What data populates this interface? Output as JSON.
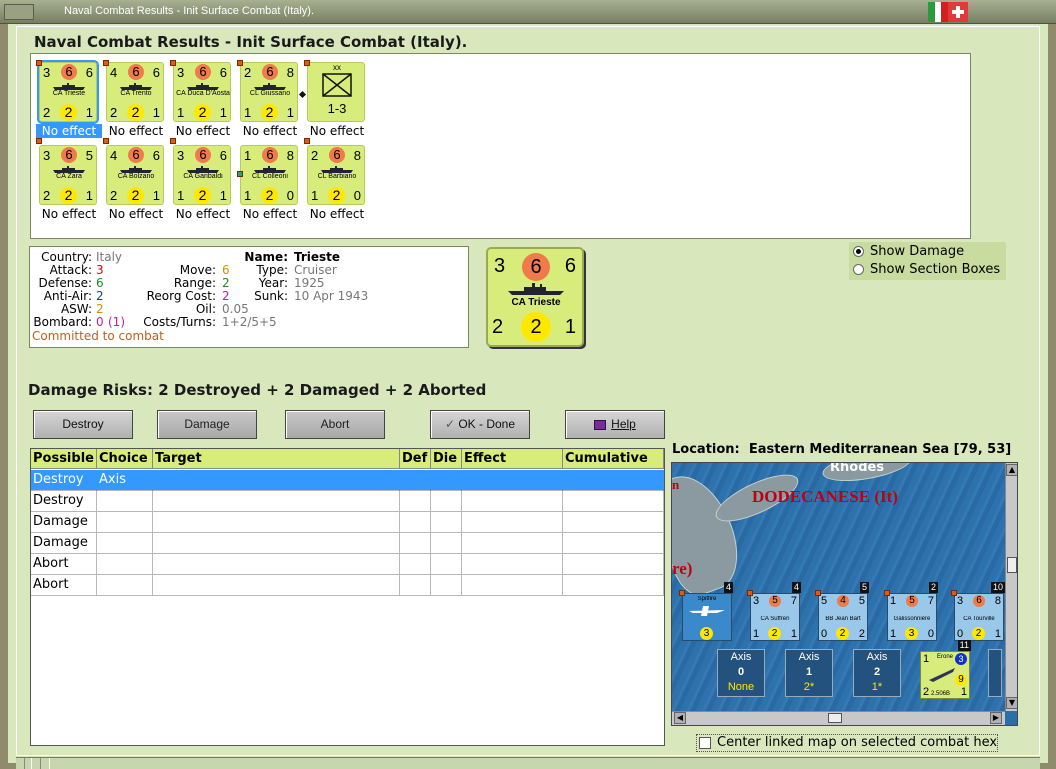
{
  "window": {
    "title": "Naval Combat Results - Init Surface Combat (Italy)."
  },
  "heading": "Naval Combat Results - Init Surface Combat (Italy).",
  "units": [
    {
      "name": "CA Trieste",
      "tl": "3",
      "mid": "6",
      "tr": "6",
      "bl": "2",
      "bot": "2",
      "br": "1",
      "effect": "No effect",
      "selected": true
    },
    {
      "name": "CA Trento",
      "tl": "4",
      "mid": "6",
      "tr": "6",
      "bl": "2",
      "bot": "2",
      "br": "1",
      "effect": "No effect"
    },
    {
      "name": "CA Duca D'Aosta",
      "tl": "3",
      "mid": "6",
      "tr": "6",
      "bl": "1",
      "bot": "2",
      "br": "1",
      "effect": "No effect"
    },
    {
      "name": "CL Giussano",
      "tl": "2",
      "mid": "6",
      "tr": "8",
      "bl": "1",
      "bot": "2",
      "br": "1",
      "effect": "No effect"
    },
    {
      "name": "",
      "corps": "xx",
      "ratio": "1-3",
      "effect": "No effect"
    },
    {
      "name": "CA Zara",
      "tl": "3",
      "mid": "6",
      "tr": "5",
      "bl": "2",
      "bot": "2",
      "br": "1",
      "effect": "No effect"
    },
    {
      "name": "CA Bolzano",
      "tl": "4",
      "mid": "6",
      "tr": "6",
      "bl": "2",
      "bot": "2",
      "br": "1",
      "effect": "No effect"
    },
    {
      "name": "CA Garibaldi",
      "tl": "3",
      "mid": "6",
      "tr": "6",
      "bl": "1",
      "bot": "2",
      "br": "1",
      "effect": "No effect"
    },
    {
      "name": "CL Colleoni",
      "tl": "1",
      "mid": "6",
      "tr": "8",
      "bl": "1",
      "bot": "2",
      "br": "0",
      "effect": "No effect"
    },
    {
      "name": "CL Barbiano",
      "tl": "2",
      "mid": "6",
      "tr": "8",
      "bl": "1",
      "bot": "2",
      "br": "0",
      "effect": "No effect"
    }
  ],
  "info": {
    "country_label": "Country:",
    "country": "Italy",
    "attack_label": "Attack:",
    "attack": "3",
    "defense_label": "Defense:",
    "defense": "6",
    "antiair_label": "Anti-Air:",
    "antiair": "2",
    "asw_label": "ASW:",
    "asw": "2",
    "bombard_label": "Bombard:",
    "bombard": "0",
    "bombard_extra": "(1)",
    "committed": "Committed to combat",
    "move_label": "Move:",
    "move": "6",
    "range_label": "Range:",
    "range": "2",
    "reorg_label": "Reorg Cost:",
    "reorg": "2",
    "oil_label": "Oil:",
    "oil": "0.05",
    "costs_label": "Costs/Turns:",
    "costs": "1+2/5+5",
    "name_label": "Name:",
    "name": "Trieste",
    "type_label": "Type:",
    "type": "Cruiser",
    "year_label": "Year:",
    "year": "1925",
    "sunk_label": "Sunk:",
    "sunk": "10 Apr 1943"
  },
  "big_counter": {
    "tl": "3",
    "mid": "6",
    "tr": "6",
    "name": "CA Trieste",
    "bl": "2",
    "bot": "2",
    "br": "1"
  },
  "options": {
    "show_damage": "Show Damage",
    "show_sections": "Show Section Boxes"
  },
  "risks": "Damage Risks:  2 Destroyed + 2 Damaged + 2 Aborted",
  "buttons": {
    "destroy": "Destroy",
    "damage": "Damage",
    "abort": "Abort",
    "ok": "OK - Done",
    "help": "Help"
  },
  "table": {
    "headers": [
      "Possible",
      "Choice",
      "Target",
      "Def",
      "Die",
      "Effect",
      "Cumulative"
    ],
    "rows": [
      {
        "possible": "Destroy",
        "choice": "Axis"
      },
      {
        "possible": "Destroy",
        "choice": ""
      },
      {
        "possible": "Damage",
        "choice": ""
      },
      {
        "possible": "Damage",
        "choice": ""
      },
      {
        "possible": "Abort",
        "choice": ""
      },
      {
        "possible": "Abort",
        "choice": ""
      }
    ]
  },
  "location": {
    "label": "Location:",
    "value": "Eastern Mediterranean Sea [79, 53]"
  },
  "map": {
    "title": "DODECANESE (It)",
    "rhodes": "Rhodes",
    "frag_left": "n",
    "frag_re": "re)",
    "counters": [
      {
        "stack": "4",
        "name": "Spitfire",
        "bot": "3"
      },
      {
        "stack": "4",
        "tl": "3",
        "mid": "5",
        "tr": "7",
        "name": "CA Suffren",
        "bl": "1",
        "bot": "2",
        "br": "1"
      },
      {
        "stack": "5",
        "tl": "5",
        "mid": "4",
        "tr": "5",
        "name": "BB Jean Bart",
        "bl": "0",
        "bot": "2",
        "br": "2"
      },
      {
        "stack": "2",
        "tl": "1",
        "mid": "5",
        "tr": "7",
        "name": "Galissonnière",
        "bl": "1",
        "bot": "3",
        "br": "0"
      },
      {
        "stack": "10",
        "tl": "3",
        "mid": "6",
        "tr": "8",
        "name": "CA Tourville",
        "bl": "0",
        "bot": "2",
        "br": "1"
      }
    ],
    "axis_boxes": [
      {
        "label": "Axis",
        "num": "0",
        "sub": "None"
      },
      {
        "label": "Axis",
        "num": "1",
        "sub": "2*"
      },
      {
        "label": "Axis",
        "num": "2",
        "sub": "1*"
      }
    ],
    "erone": {
      "stack": "11",
      "name": "Erone",
      "tl": "1",
      "circ": "3",
      "v": "9",
      "bl": "2",
      "code": "2.506B",
      "br": "1"
    }
  },
  "center_map": "Center linked map on selected combat hex",
  "colors": {
    "counter": "#d8ec7c",
    "selection": "#3399ff",
    "panel": "#d9e8bc"
  }
}
